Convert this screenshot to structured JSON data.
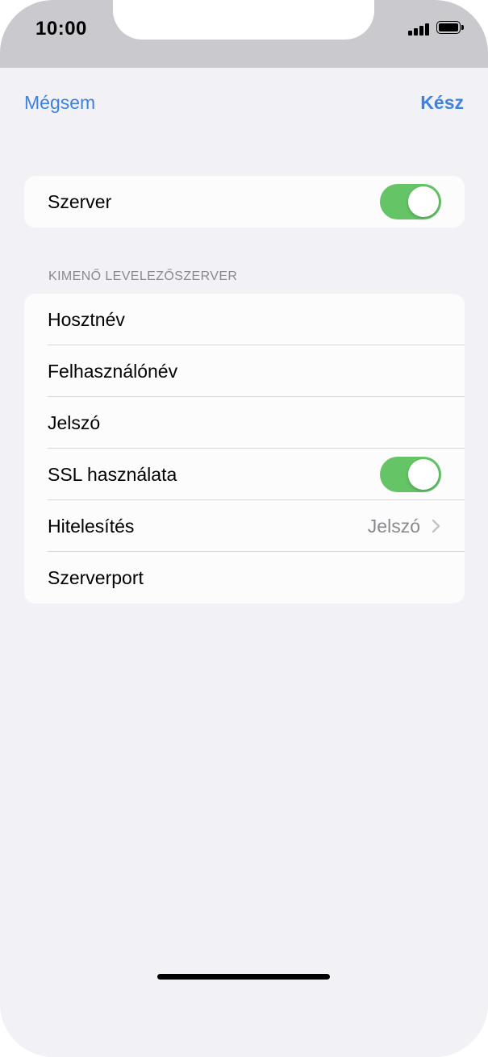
{
  "status_bar": {
    "time": "10:00",
    "signal_icon": "cellular-signal-icon",
    "battery_icon": "battery-icon"
  },
  "nav": {
    "cancel_label": "Mégsem",
    "done_label": "Kész",
    "accent_color": "#3e82e0"
  },
  "server_toggle": {
    "label": "Szerver",
    "on": true
  },
  "outgoing_section": {
    "header": "KIMENŐ LEVELEZŐSZERVER",
    "rows": [
      {
        "label": "Hosztnév"
      },
      {
        "label": "Felhasználónév"
      },
      {
        "label": "Jelszó"
      },
      {
        "label": "SSL használata",
        "toggle_on": true
      },
      {
        "label": "Hitelesítés",
        "value": "Jelszó",
        "icon": "chevron-right-icon"
      },
      {
        "label": "Szerverport"
      }
    ]
  },
  "colors": {
    "toggle_on": "#64c466",
    "background": "#f1f1f6",
    "card": "#fcfcfd"
  }
}
